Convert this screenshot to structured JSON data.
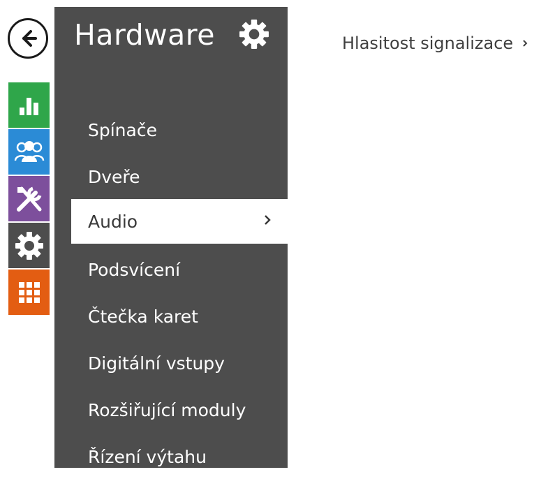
{
  "header": {
    "title": "Hardware"
  },
  "menu": {
    "items": [
      {
        "label": "Spínače"
      },
      {
        "label": "Dveře"
      },
      {
        "label": "Audio"
      },
      {
        "label": "Podsvícení"
      },
      {
        "label": "Čtečka karet"
      },
      {
        "label": "Digitální vstupy"
      },
      {
        "label": "Rozšiřující moduly"
      },
      {
        "label": "Řízení výtahu"
      }
    ],
    "active_index": 2
  },
  "breadcrumb": {
    "sub_item": "Hlasitost signalizace"
  },
  "rail": {
    "tiles": [
      {
        "icon": "bar-chart-icon",
        "color": "#2fa64a"
      },
      {
        "icon": "users-icon",
        "color": "#2b8bd6"
      },
      {
        "icon": "tools-icon",
        "color": "#7d4f9c"
      },
      {
        "icon": "gear-icon",
        "color": "#4d4d4d"
      },
      {
        "icon": "grid-icon",
        "color": "#e35d12"
      }
    ]
  },
  "icons": {
    "back": "back-arrow-icon",
    "header": "gear-icon",
    "chevron": "chevron-right-icon"
  },
  "colors": {
    "panel": "#4d4d4d",
    "active_bg": "#ffffff",
    "panel_text": "#ffffff"
  }
}
